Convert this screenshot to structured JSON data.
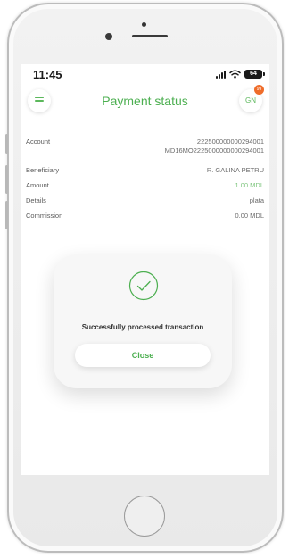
{
  "status_bar": {
    "time": "11:45",
    "battery_level": "64"
  },
  "header": {
    "title": "Payment status",
    "profile_initials": "GN",
    "notification_count": "99"
  },
  "details": {
    "account": {
      "label": "Account",
      "value_line1": "222500000000294001",
      "value_line2": "MD16MO2225000000000294001"
    },
    "beneficiary": {
      "label": "Beneficiary",
      "value": "R. GALINA PETRU"
    },
    "amount": {
      "label": "Amount",
      "value": "1.00 MDL"
    },
    "details_field": {
      "label": "Details",
      "value": "plata"
    },
    "commission": {
      "label": "Commission",
      "value": "0.00 MDL"
    }
  },
  "dialog": {
    "message": "Successfully processed transaction",
    "close_label": "Close"
  },
  "colors": {
    "accent": "#4caf50",
    "badge": "#ef6c2a",
    "amount_value": "#7cc47c"
  },
  "icons": {
    "menu": "hamburger-menu-icon",
    "check": "check-circle-icon",
    "signal": "signal-icon",
    "wifi": "wifi-icon",
    "battery": "battery-icon"
  }
}
